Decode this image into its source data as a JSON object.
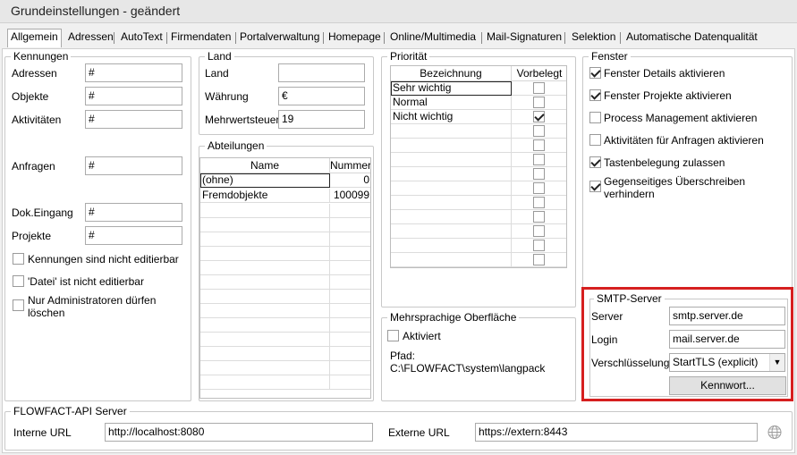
{
  "window": {
    "title": "Grundeinstellungen - geändert"
  },
  "tabs": [
    "Allgemein",
    "Adressen",
    "AutoText",
    "Firmendaten",
    "Portalverwaltung",
    "Homepage",
    "Online/Multimedia",
    "Mail-Signaturen",
    "Selektion",
    "Automatische Datenqualität"
  ],
  "kennungen": {
    "legend": "Kennungen",
    "fields": [
      {
        "label": "Adressen",
        "value": "#"
      },
      {
        "label": "Objekte",
        "value": "#"
      },
      {
        "label": "Aktivitäten",
        "value": "#"
      },
      {
        "label": "Anfragen",
        "value": "#"
      },
      {
        "label": "Dok.Eingang",
        "value": "#"
      },
      {
        "label": "Projekte",
        "value": "#"
      }
    ],
    "checks": [
      {
        "label": "Kennungen sind nicht editierbar",
        "checked": false
      },
      {
        "label": "'Datei' ist nicht editierbar",
        "checked": false
      },
      {
        "label": "Nur Administratoren dürfen löschen",
        "checked": false
      }
    ]
  },
  "land": {
    "legend": "Land",
    "fields": [
      {
        "label": "Land",
        "value": ""
      },
      {
        "label": "Währung",
        "value": "€"
      },
      {
        "label": "Mehrwertsteuer",
        "value": "19"
      }
    ]
  },
  "abteilungen": {
    "legend": "Abteilungen",
    "columns": [
      "Name",
      "Nummer"
    ],
    "rows": [
      {
        "name": "(ohne)",
        "nummer": "0"
      },
      {
        "name": "Fremdobjekte",
        "nummer": "100099"
      }
    ]
  },
  "prioritaet": {
    "legend": "Priorität",
    "columns": [
      "Bezeichnung",
      "Vorbelegt"
    ],
    "rows": [
      {
        "name": "Sehr wichtig",
        "checked": false
      },
      {
        "name": "Normal",
        "checked": false
      },
      {
        "name": "Nicht wichtig",
        "checked": true
      }
    ]
  },
  "mehrsprachig": {
    "legend": "Mehrsprachige Oberfläche",
    "check_label": "Aktiviert",
    "checked": false,
    "pfad_label": "Pfad:",
    "pfad_value": "C:\\FLOWFACT\\system\\langpack"
  },
  "fenster": {
    "legend": "Fenster",
    "checks": [
      {
        "label": "Fenster Details aktivieren",
        "checked": true
      },
      {
        "label": "Fenster Projekte aktivieren",
        "checked": true
      },
      {
        "label": "Process Management aktivieren",
        "checked": false
      },
      {
        "label": "Aktivitäten für Anfragen aktivieren",
        "checked": false
      },
      {
        "label": "Tastenbelegung zulassen",
        "checked": true
      },
      {
        "label": "Gegenseitiges Überschreiben verhindern",
        "checked": true
      }
    ]
  },
  "smtp": {
    "legend": "SMTP-Server",
    "server_label": "Server",
    "server_value": "smtp.server.de",
    "login_label": "Login",
    "login_value": "mail.server.de",
    "encryption_label": "Verschlüsselung",
    "encryption_value": "StartTLS (explicit)",
    "password_button": "Kennwort..."
  },
  "api": {
    "legend": "FLOWFACT-API Server",
    "intern_label": "Interne URL",
    "intern_value": "http://localhost:8080",
    "extern_label": "Externe URL",
    "extern_value": "https://extern:8443"
  },
  "colors": {
    "highlight": "#d61f1f"
  },
  "icons": {
    "globe": "globe-icon"
  }
}
